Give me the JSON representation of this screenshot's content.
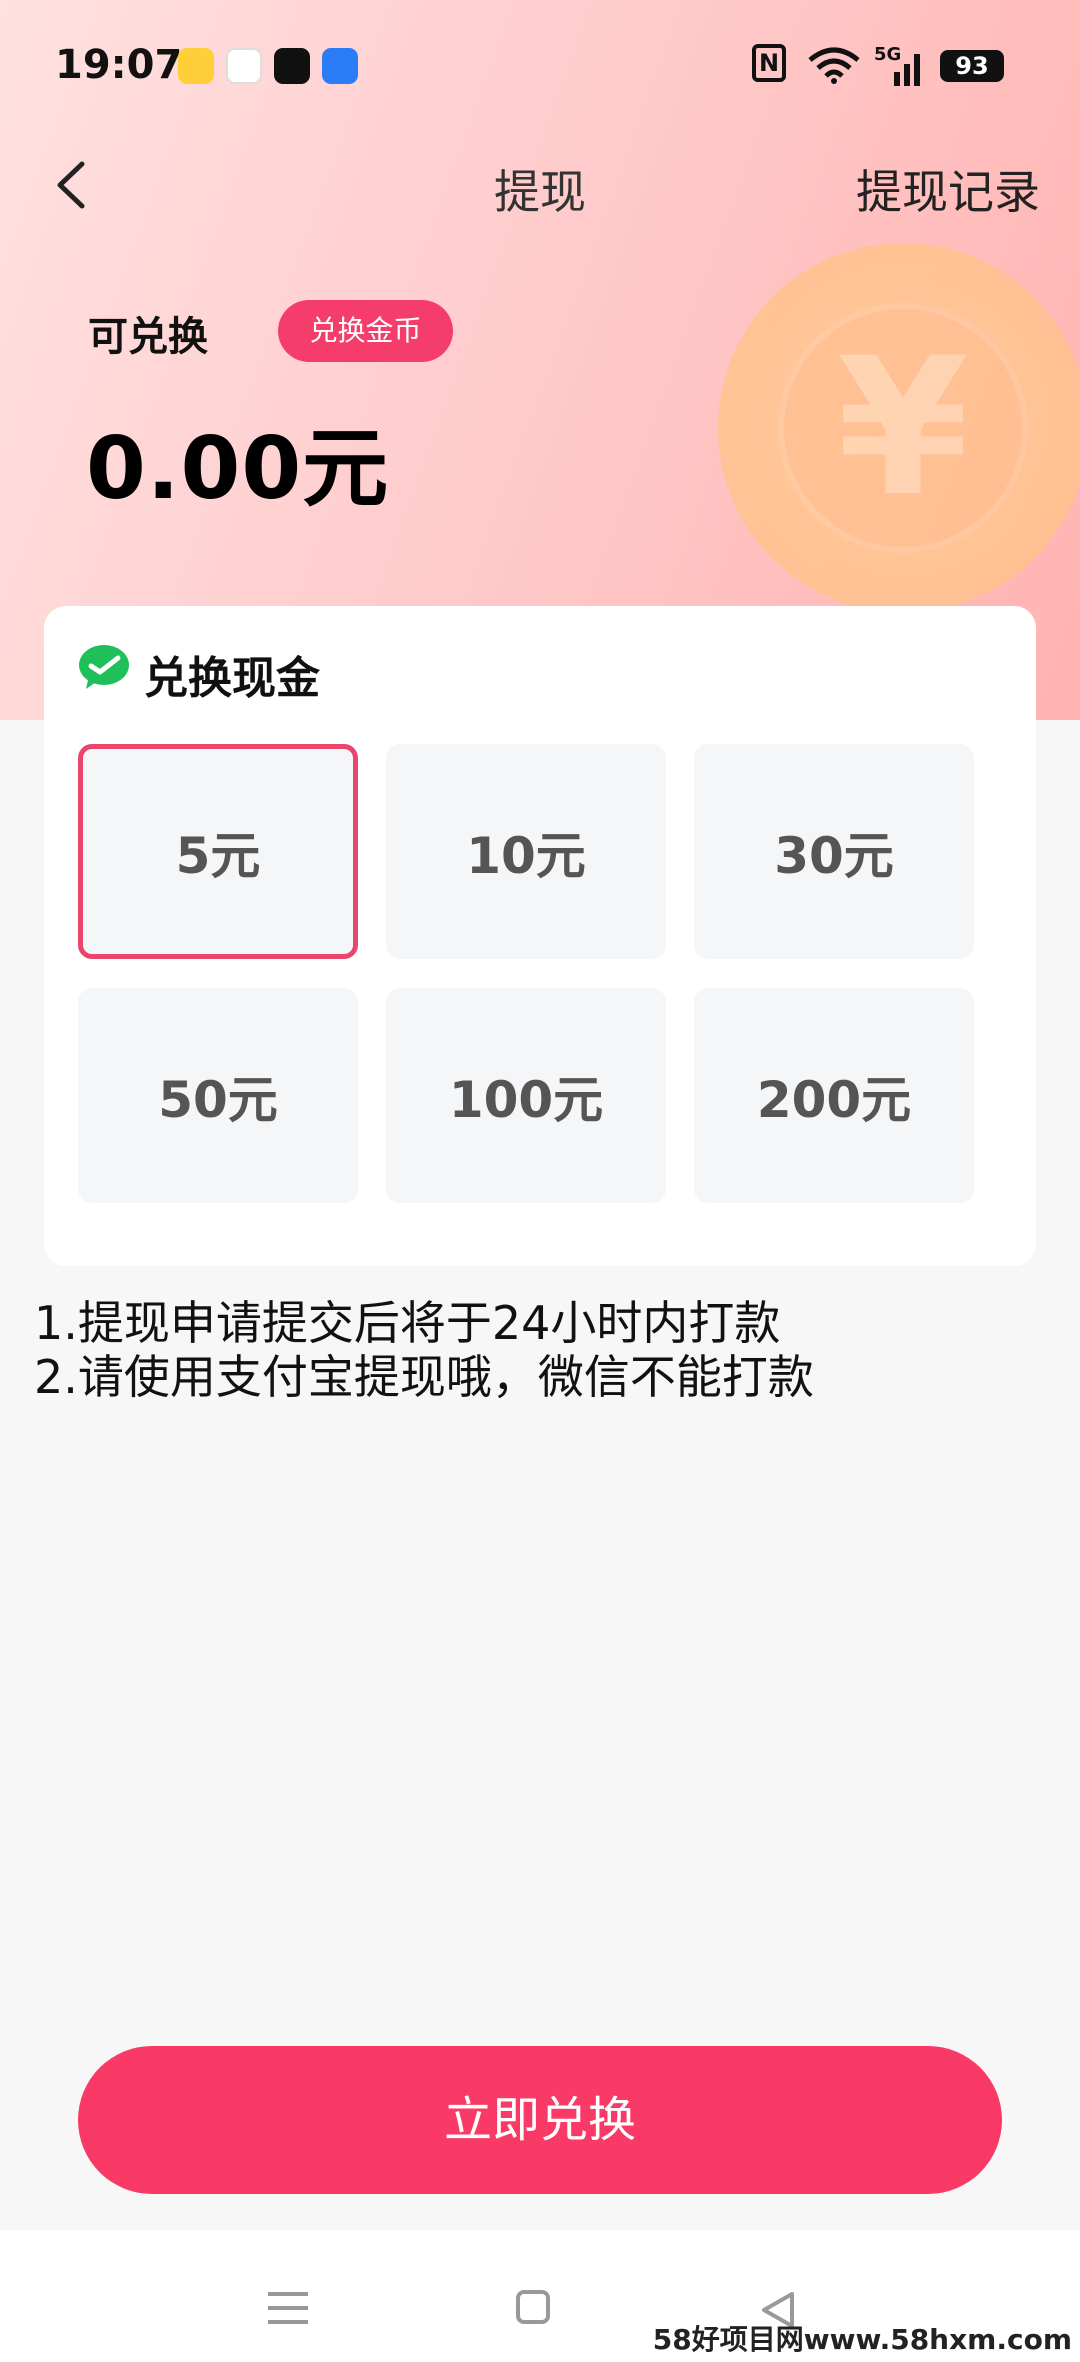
{
  "status_bar": {
    "time": "19:07",
    "battery": "93",
    "network": "5G"
  },
  "nav": {
    "title": "提现",
    "right_link": "提现记录"
  },
  "balance": {
    "label": "可兑换",
    "exchange_button": "兑换金币",
    "amount": "0.00元"
  },
  "card": {
    "title": "兑换现金",
    "options": [
      "5元",
      "10元",
      "30元",
      "50元",
      "100元",
      "200元"
    ],
    "selected_index": 0
  },
  "notes": [
    "1.提现申请提交后将于24小时内打款",
    "2.请使用支付宝提现哦，微信不能打款"
  ],
  "submit_label": "立即兑换",
  "watermark": "58好项目网www.58hxm.com",
  "colors": {
    "accent": "#fa3a66",
    "selected_border": "#e8466c",
    "header_gradient_end": "#ffb3b1"
  }
}
